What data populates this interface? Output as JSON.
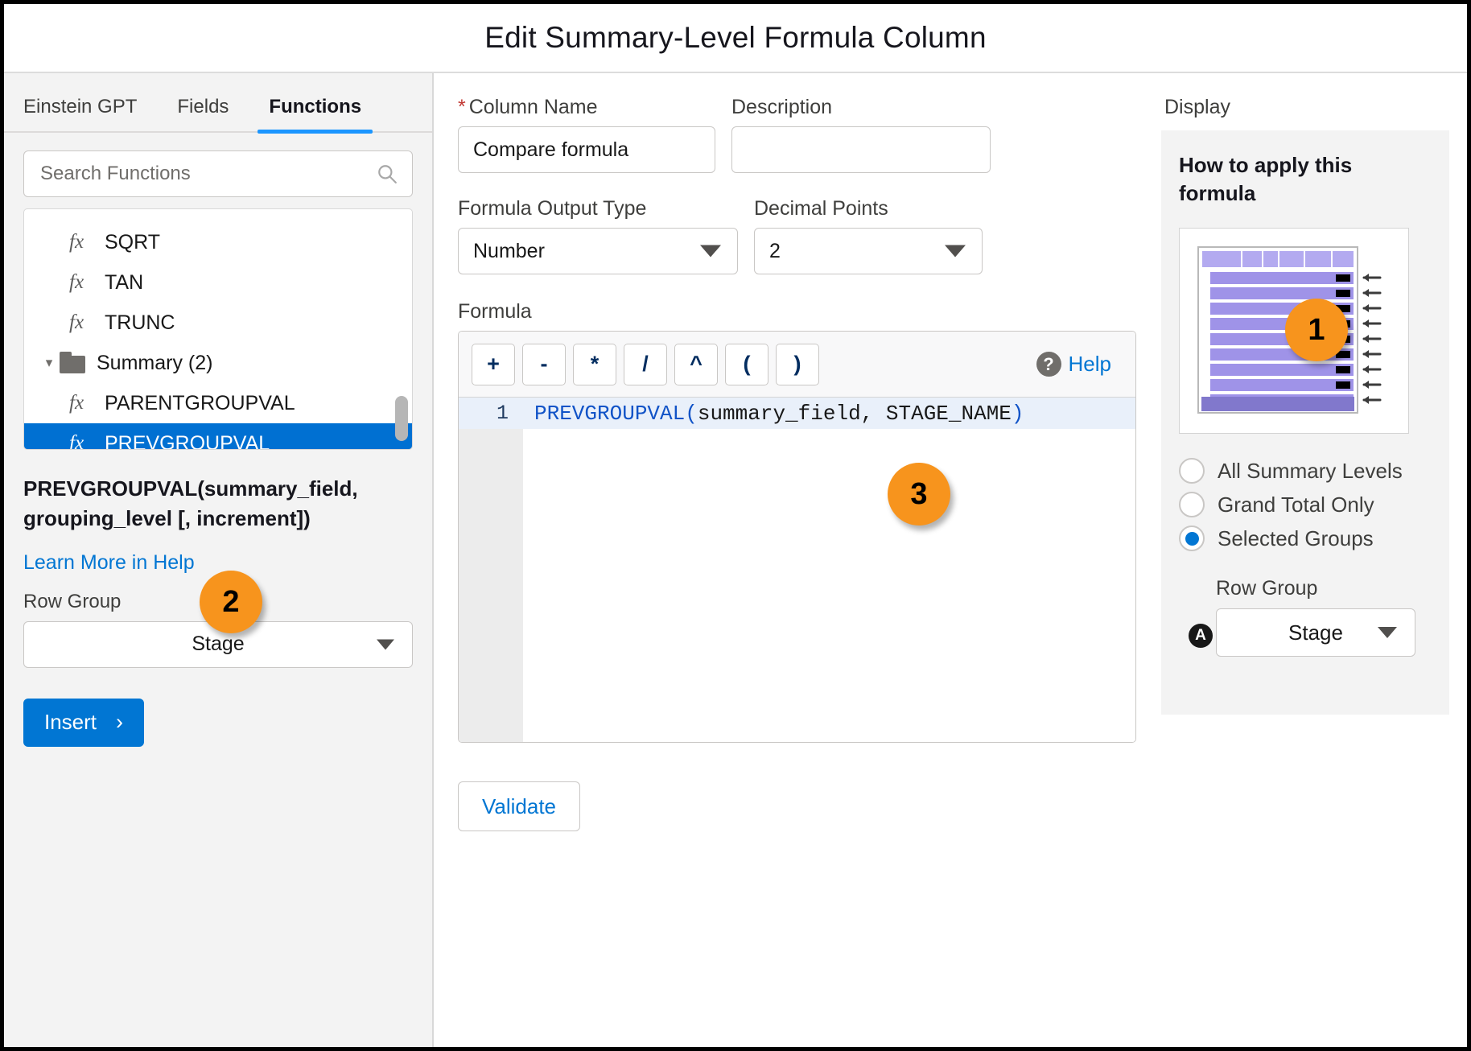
{
  "header": {
    "title": "Edit Summary-Level Formula Column"
  },
  "left": {
    "tabs": [
      {
        "label": "Einstein GPT",
        "active": false
      },
      {
        "label": "Fields",
        "active": false
      },
      {
        "label": "Functions",
        "active": true
      }
    ],
    "search": {
      "placeholder": "Search Functions",
      "value": "",
      "icon": "search-icon"
    },
    "function_list": [
      {
        "label": "SQRT",
        "type": "function",
        "selected": false
      },
      {
        "label": "TAN",
        "type": "function",
        "selected": false
      },
      {
        "label": "TRUNC",
        "type": "function",
        "selected": false
      },
      {
        "label": "Summary (2)",
        "type": "folder",
        "expanded": true
      },
      {
        "label": "PARENTGROUPVAL",
        "type": "function",
        "selected": false
      },
      {
        "label": "PREVGROUPVAL",
        "type": "function",
        "selected": true
      }
    ],
    "signature": "PREVGROUPVAL(summary_field, grouping_level [, increment])",
    "learn_more": "Learn More in Help",
    "row_group_label": "Row Group",
    "row_group_value": "Stage",
    "insert_label": "Insert",
    "insert_arrow": "›"
  },
  "main": {
    "column_name_label": "Column Name",
    "column_name_required": "*",
    "column_name_value": "Compare formula",
    "description_label": "Description",
    "description_value": "",
    "output_type_label": "Formula Output Type",
    "output_type_value": "Number",
    "decimal_points_label": "Decimal Points",
    "decimal_points_value": "2",
    "formula_label": "Formula",
    "operators": [
      "+",
      "-",
      "*",
      "/",
      "^",
      "(",
      ")"
    ],
    "help_label": "Help",
    "help_icon": "question-mark-icon",
    "line_number": "1",
    "formula_tokens": {
      "fn": "PREVGROUPVAL",
      "open": "(",
      "args": "summary_field, STAGE_NAME",
      "close": ")"
    },
    "formula_text": "PREVGROUPVAL(summary_field, STAGE_NAME)",
    "validate_label": "Validate"
  },
  "display": {
    "panel_label": "Display",
    "card_heading": "How to apply this formula",
    "options": [
      {
        "label": "All Summary Levels",
        "selected": false
      },
      {
        "label": "Grand Total Only",
        "selected": false
      },
      {
        "label": "Selected Groups",
        "selected": true
      }
    ],
    "row_group_label": "Row Group",
    "row_group_value": "Stage",
    "anchor_icon": "anchor-a-icon"
  },
  "badges": [
    {
      "number": "1",
      "target": "display-panel"
    },
    {
      "number": "2",
      "target": "function-signature"
    },
    {
      "number": "3",
      "target": "formula-editor"
    }
  ],
  "colors": {
    "accent_blue": "#0176d3",
    "selected_row": "#0070d2",
    "badge_orange": "#f7941d",
    "tab_underline": "#1b96ff",
    "required_red": "#c23934",
    "code_blue": "#1153c7",
    "diagram_header": "#b3aaf0",
    "diagram_row": "#9f93e8",
    "diagram_total": "#8178cc"
  }
}
